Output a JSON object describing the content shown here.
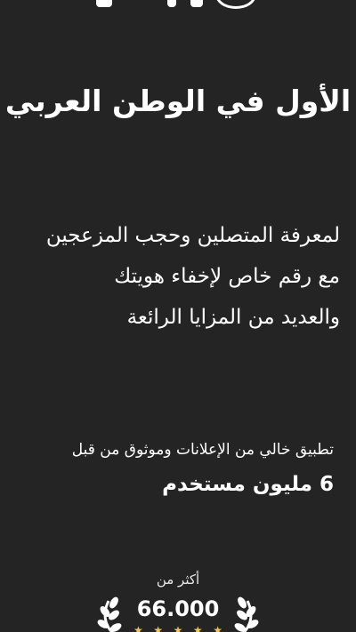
{
  "headline": "الأول في الوطن العربي",
  "features": {
    "line1": "لمعرفة المتصلين وحجب المزعجين",
    "line2": "مع رقم خاص لإخفاء هويتك",
    "line3": "والعديد من المزايا الرائعة"
  },
  "trust": {
    "adfree_text": "تطبيق خالي من الإعلانات وموثوق من قبل",
    "users_text": "6 مليون مستخدم"
  },
  "rating": {
    "more_than_label": "أكثر من",
    "count": "66.000",
    "stars": 5
  },
  "icons": {
    "laurel_left": "laurel-wreath-icon",
    "laurel_right": "laurel-wreath-icon",
    "star": "star-icon"
  },
  "colors": {
    "background": "#242424",
    "text": "#ffffff",
    "star": "#f4c542"
  }
}
